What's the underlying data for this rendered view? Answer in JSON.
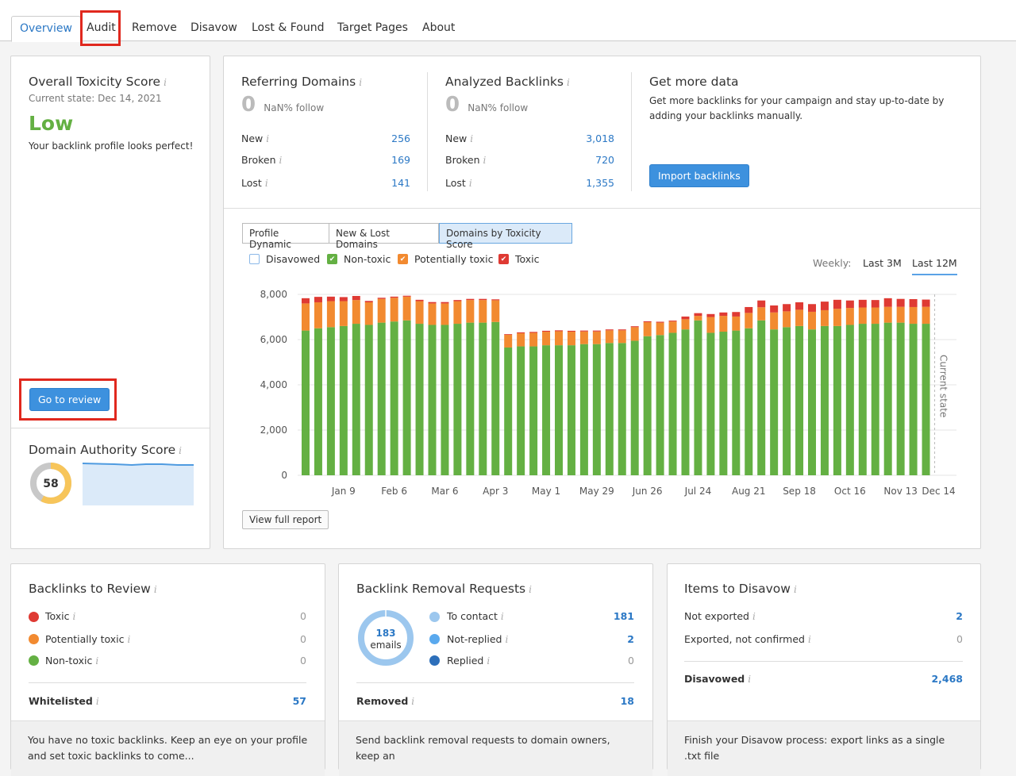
{
  "tabs": [
    {
      "label": "Overview",
      "active": true
    },
    {
      "label": "Audit",
      "highlighted": true
    },
    {
      "label": "Remove"
    },
    {
      "label": "Disavow"
    },
    {
      "label": "Lost & Found"
    },
    {
      "label": "Target Pages"
    },
    {
      "label": "About"
    }
  ],
  "toxicity": {
    "title": "Overall Toxicity Score",
    "current_state": "Current state: Dec 14, 2021",
    "level": "Low",
    "level_color": "#64b043",
    "description": "Your backlink profile looks perfect!",
    "review_button": "Go to review"
  },
  "authority": {
    "title": "Domain Authority Score",
    "score": "58",
    "score_fraction": 0.58,
    "score_color": "#f7c55a"
  },
  "referring_domains": {
    "title": "Referring Domains",
    "total": "0",
    "follow": "NaN% follow",
    "rows": [
      {
        "label": "New",
        "value": "256"
      },
      {
        "label": "Broken",
        "value": "169"
      },
      {
        "label": "Lost",
        "value": "141"
      }
    ]
  },
  "analyzed_backlinks": {
    "title": "Analyzed Backlinks",
    "total": "0",
    "follow": "NaN% follow",
    "rows": [
      {
        "label": "New",
        "value": "3,018"
      },
      {
        "label": "Broken",
        "value": "720"
      },
      {
        "label": "Lost",
        "value": "1,355"
      }
    ]
  },
  "get_more": {
    "title": "Get more data",
    "text": "Get more backlinks for your campaign and stay up-to-date by adding your backlinks manually.",
    "button": "Import backlinks"
  },
  "chart_tabs": [
    {
      "label": "Profile Dynamic"
    },
    {
      "label": "New & Lost Domains"
    },
    {
      "label": "Domains by Toxicity Score",
      "active": true
    }
  ],
  "legend": [
    {
      "label": "Disavowed",
      "color": "#ffffff",
      "checked": false
    },
    {
      "label": "Non-toxic",
      "color": "#64b043",
      "checked": true
    },
    {
      "label": "Potentially toxic",
      "color": "#f28a30",
      "checked": true
    },
    {
      "label": "Toxic",
      "color": "#df3a33",
      "checked": true
    }
  ],
  "period": {
    "label": "Weekly:",
    "options": [
      {
        "label": "Last 3M"
      },
      {
        "label": "Last 12M",
        "active": true
      }
    ]
  },
  "view_full_report": "View full report",
  "chart_data": {
    "type": "bar",
    "stacked": true,
    "title": "Domains by Toxicity Score",
    "xlabel": "",
    "ylabel": "",
    "ylim": [
      0,
      8000
    ],
    "yticks": [
      0,
      2000,
      4000,
      6000,
      8000
    ],
    "ytick_labels": [
      "0",
      "2,000",
      "4,000",
      "6,000",
      "8,000"
    ],
    "xtick_labels": [
      "Jan 9",
      "Feb 6",
      "Mar 6",
      "Apr 3",
      "May 1",
      "May 29",
      "Jun 26",
      "Jul 24",
      "Aug 21",
      "Sep 18",
      "Oct 16",
      "Nov 13",
      "Dec 14"
    ],
    "xtick_bar_index": [
      3,
      7,
      11,
      15,
      19,
      23,
      27,
      31,
      35,
      39,
      43,
      47,
      50
    ],
    "annotation": "Current state",
    "grid": true,
    "legend_position": "top-left",
    "series": [
      {
        "name": "Non-toxic",
        "color": "#64b043",
        "values": [
          6400,
          6500,
          6550,
          6600,
          6700,
          6650,
          6750,
          6800,
          6850,
          6700,
          6650,
          6650,
          6700,
          6750,
          6750,
          6780,
          5650,
          5700,
          5700,
          5750,
          5750,
          5750,
          5800,
          5800,
          5850,
          5850,
          5950,
          6150,
          6200,
          6300,
          6450,
          6850,
          6300,
          6350,
          6400,
          6500,
          6850,
          6450,
          6550,
          6600,
          6450,
          6600,
          6600,
          6650,
          6700,
          6700,
          6750,
          6750,
          6700,
          6700
        ]
      },
      {
        "name": "Potentially toxic",
        "color": "#f28a30",
        "values": [
          1200,
          1150,
          1150,
          1100,
          1050,
          1000,
          1050,
          1050,
          1050,
          1000,
          950,
          950,
          1000,
          1000,
          1000,
          960,
          560,
          580,
          600,
          600,
          620,
          600,
          560,
          560,
          560,
          560,
          600,
          620,
          550,
          500,
          450,
          200,
          700,
          700,
          620,
          680,
          580,
          750,
          700,
          720,
          780,
          700,
          760,
          750,
          720,
          720,
          700,
          700,
          740,
          750
        ]
      },
      {
        "name": "Toxic",
        "color": "#df3a33",
        "values": [
          230,
          240,
          200,
          180,
          180,
          60,
          50,
          50,
          40,
          60,
          60,
          60,
          50,
          50,
          50,
          40,
          30,
          40,
          40,
          40,
          40,
          40,
          40,
          40,
          40,
          40,
          40,
          40,
          40,
          40,
          120,
          120,
          130,
          150,
          200,
          260,
          300,
          310,
          320,
          330,
          340,
          380,
          400,
          330,
          340,
          330,
          380,
          350,
          350,
          320
        ]
      },
      {
        "name": "Disavowed",
        "color": "#ffffff",
        "values": []
      }
    ]
  },
  "backlinks_review": {
    "title": "Backlinks to Review",
    "rows": [
      {
        "label": "Toxic",
        "value": "0",
        "color": "#df3a33"
      },
      {
        "label": "Potentially toxic",
        "value": "0",
        "color": "#f28a30"
      },
      {
        "label": "Non-toxic",
        "value": "0",
        "color": "#64b043"
      }
    ],
    "whitelisted_label": "Whitelisted",
    "whitelisted_value": "57",
    "footer": "You have no toxic backlinks. Keep an eye on your profile and set toxic backlinks to come..."
  },
  "removal_requests": {
    "title": "Backlink Removal Requests",
    "donut_count": "183",
    "donut_unit": "emails",
    "rows": [
      {
        "label": "To contact",
        "value": "181",
        "color": "#9cc7ee"
      },
      {
        "label": "Not-replied",
        "value": "2",
        "color": "#5aa9ee"
      },
      {
        "label": "Replied",
        "value": "0",
        "color": "#2d6fba"
      }
    ],
    "removed_label": "Removed",
    "removed_value": "18",
    "footer": "Send backlink removal requests to domain owners, keep an"
  },
  "disavow": {
    "title": "Items to Disavow",
    "rows": [
      {
        "label": "Not exported",
        "value": "2"
      },
      {
        "label": "Exported, not confirmed",
        "value": "0"
      }
    ],
    "disavowed_label": "Disavowed",
    "disavowed_value": "2,468",
    "footer": "Finish your Disavow process: export links as a single .txt file"
  }
}
